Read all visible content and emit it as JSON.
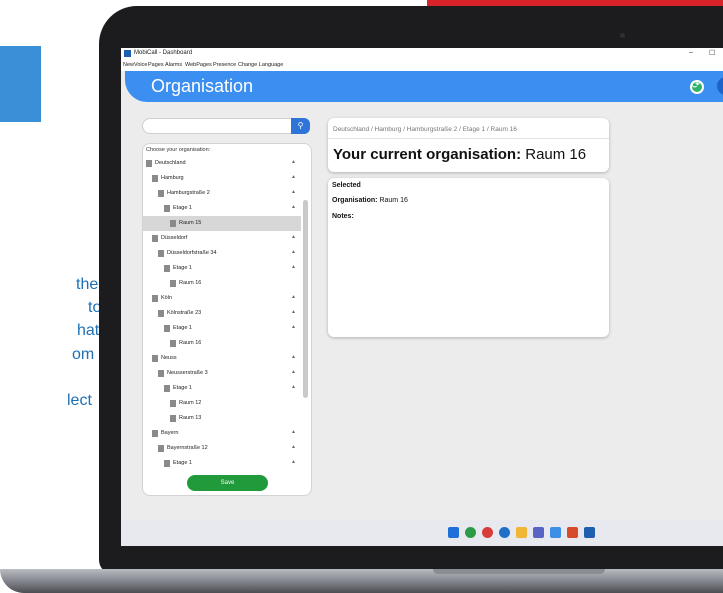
{
  "window": {
    "title": "MobiCall - Dashboard"
  },
  "menu": [
    "NewVoice",
    "Pages",
    "Alarms",
    "WebPages",
    "Presence",
    "Change Language"
  ],
  "header": {
    "title": "Organisation"
  },
  "side_text": [
    "the",
    "to",
    "hat",
    "om",
    "lect"
  ],
  "tree": {
    "heading": "Choose your organisation:",
    "items": [
      {
        "label": "Deutschland",
        "level": 0,
        "expanded": true
      },
      {
        "label": "Hamburg",
        "level": 1,
        "expanded": true
      },
      {
        "label": "Hamburgstraße 2",
        "level": 2,
        "expanded": true
      },
      {
        "label": "Etage 1",
        "level": 3,
        "expanded": true
      },
      {
        "label": "Raum 15",
        "level": 4,
        "selected": true
      },
      {
        "label": "Düsseldorf",
        "level": 1,
        "expanded": true
      },
      {
        "label": "Düsseldorfstraße 34",
        "level": 2,
        "expanded": true
      },
      {
        "label": "Etage 1",
        "level": 3,
        "expanded": true
      },
      {
        "label": "Raum 16",
        "level": 4
      },
      {
        "label": "Köln",
        "level": 1,
        "expanded": true
      },
      {
        "label": "Kölnstraße 23",
        "level": 2,
        "expanded": true
      },
      {
        "label": "Etage 1",
        "level": 3,
        "expanded": true
      },
      {
        "label": "Raum 16",
        "level": 4
      },
      {
        "label": "Neuss",
        "level": 1,
        "expanded": true
      },
      {
        "label": "Neusserstraße 3",
        "level": 2,
        "expanded": true
      },
      {
        "label": "Etage 1",
        "level": 3,
        "expanded": true
      },
      {
        "label": "Raum 12",
        "level": 4
      },
      {
        "label": "Raum 13",
        "level": 4
      },
      {
        "label": "Bayern",
        "level": 1,
        "expanded": true
      },
      {
        "label": "Bayernstraße 12",
        "level": 2,
        "expanded": true
      },
      {
        "label": "Etage 1",
        "level": 3,
        "expanded": true
      }
    ],
    "save_label": "Save"
  },
  "breadcrumb": "Deutschland / Hamburg / Hamburgstraße 2 / Etage 1 / Raum 16",
  "current": {
    "prefix": "Your current organisation:",
    "value": "Raum 16"
  },
  "details": {
    "selected_heading": "Selected",
    "org_label": "Organisation:",
    "org_value": "Raum 16",
    "notes_label": "Notes:"
  },
  "colors": {
    "accent": "#3b8ff0",
    "save": "#209a3b",
    "brand_red": "#d8232a",
    "refresh": "#2fb36b"
  },
  "taskbar_icons": [
    "windows-start-icon",
    "chrome-icon",
    "opera-icon",
    "settings-icon",
    "file-explorer-icon",
    "teams-icon",
    "notepad-icon",
    "office-icon",
    "mobicall-icon"
  ]
}
